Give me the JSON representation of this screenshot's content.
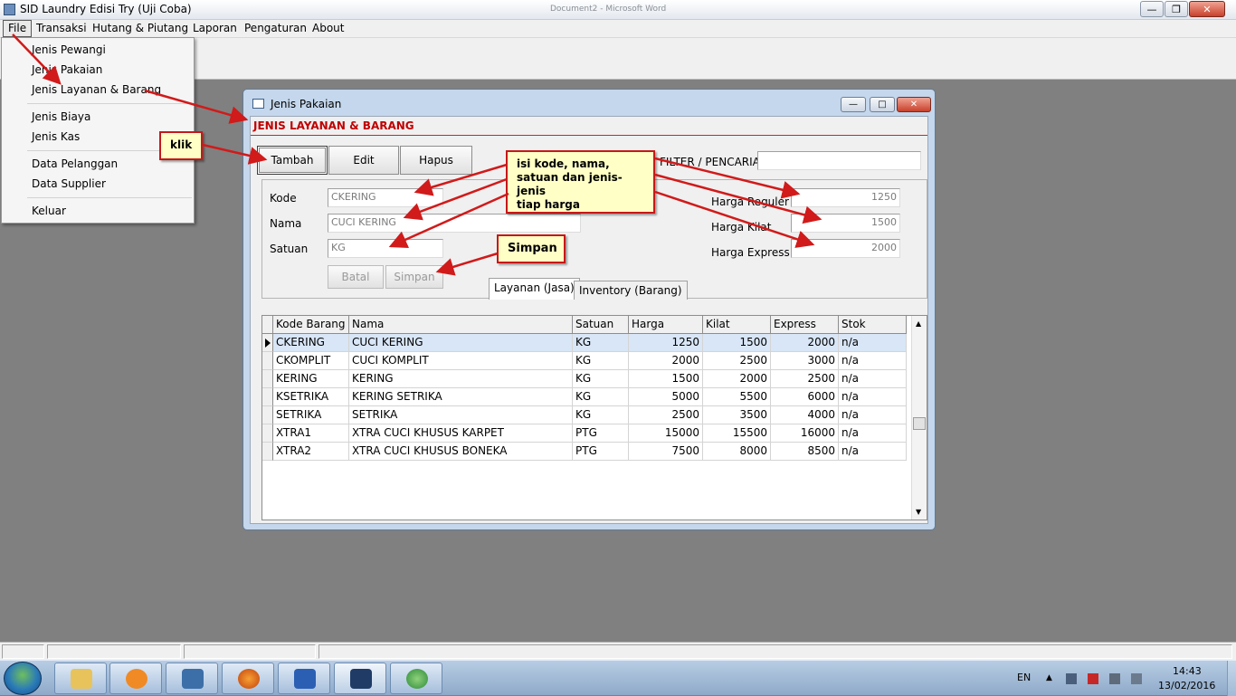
{
  "app": {
    "title": "SID Laundry Edisi Try (Uji Coba)",
    "background_window_title": "Document2 - Microsoft Word"
  },
  "menubar": [
    "File",
    "Transaksi",
    "Hutang & Piutang",
    "Laporan",
    "Pengaturan",
    "About"
  ],
  "file_menu": {
    "items": [
      "Jenis Pewangi",
      "Jenis Pakaian",
      "Jenis Layanan & Barang",
      "Jenis Biaya",
      "Jenis Kas",
      "Data Pelanggan",
      "Data Supplier",
      "Keluar"
    ]
  },
  "window": {
    "title": "Jenis Pakaian",
    "form_title": "JENIS LAYANAN & BARANG",
    "buttons": {
      "add": "Tambah",
      "edit": "Edit",
      "delete": "Hapus",
      "cancel": "Batal",
      "save": "Simpan"
    },
    "filter": {
      "label": "FILTER / PENCARIAN",
      "value": ""
    },
    "fields": {
      "kode": {
        "label": "Kode",
        "value": "CKERING"
      },
      "nama": {
        "label": "Nama",
        "value": "CUCI KERING"
      },
      "satuan": {
        "label": "Satuan",
        "value": "KG"
      },
      "harga_reguler": {
        "label": "Harga Reguler",
        "value": "1250"
      },
      "harga_kilat": {
        "label": "Harga Kilat",
        "value": "1500"
      },
      "harga_express": {
        "label": "Harga Express",
        "value": "2000"
      }
    },
    "tabs": [
      "Layanan (Jasa)",
      "Inventory (Barang)"
    ],
    "grid": {
      "columns": [
        "Kode Barang",
        "Nama",
        "Satuan",
        "Harga Reguler",
        "Kilat",
        "Express",
        "Stok"
      ],
      "rows": [
        [
          "CKERING",
          "CUCI KERING",
          "KG",
          "1250",
          "1500",
          "2000",
          "n/a"
        ],
        [
          "CKOMPLIT",
          "CUCI KOMPLIT",
          "KG",
          "2000",
          "2500",
          "3000",
          "n/a"
        ],
        [
          "KERING",
          "KERING",
          "KG",
          "1500",
          "2000",
          "2500",
          "n/a"
        ],
        [
          "KSETRIKA",
          "KERING SETRIKA",
          "KG",
          "5000",
          "5500",
          "6000",
          "n/a"
        ],
        [
          "SETRIKA",
          "SETRIKA",
          "KG",
          "2500",
          "3500",
          "4000",
          "n/a"
        ],
        [
          "XTRA1",
          "XTRA CUCI KHUSUS KARPET",
          "PTG",
          "15000",
          "15500",
          "16000",
          "n/a"
        ],
        [
          "XTRA2",
          "XTRA CUCI KHUSUS BONEKA",
          "PTG",
          "7500",
          "8000",
          "8500",
          "n/a"
        ]
      ]
    }
  },
  "annotations": {
    "klik": "klik",
    "isi_lines": [
      "isi kode, nama,",
      "satuan dan jenis-jenis",
      "tiap harga"
    ],
    "simpan": "Simpan"
  },
  "taskbar": {
    "lang": "EN",
    "time": "14:43",
    "date": "13/02/2016"
  },
  "colors": {
    "accent_red": "#c00000",
    "callout_bg": "#ffffc6",
    "arrow": "#d11a1a"
  }
}
